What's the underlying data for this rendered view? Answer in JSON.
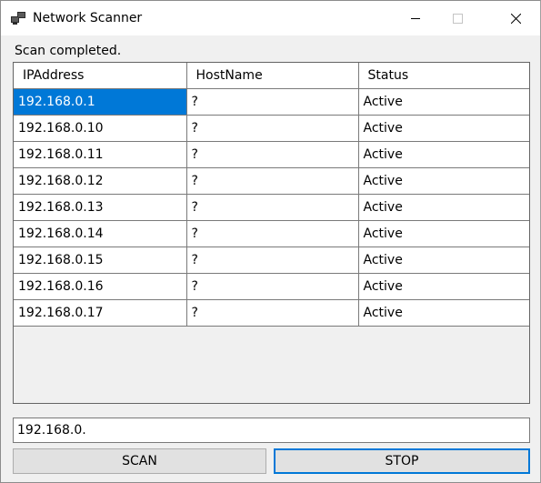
{
  "window": {
    "title": "Network Scanner",
    "icon": "network-computers-icon",
    "controls": [
      "minimize-icon",
      "maximize-icon",
      "close-icon"
    ]
  },
  "status": {
    "text": "Scan completed."
  },
  "grid": {
    "columns": [
      "IPAddress",
      "HostName",
      "Status"
    ],
    "rows": [
      {
        "ip": "192.168.0.1",
        "host": "?",
        "status": "Active"
      },
      {
        "ip": "192.168.0.10",
        "host": "?",
        "status": "Active"
      },
      {
        "ip": "192.168.0.11",
        "host": "?",
        "status": "Active"
      },
      {
        "ip": "192.168.0.12",
        "host": "?",
        "status": "Active"
      },
      {
        "ip": "192.168.0.13",
        "host": "?",
        "status": "Active"
      },
      {
        "ip": "192.168.0.14",
        "host": "?",
        "status": "Active"
      },
      {
        "ip": "192.168.0.15",
        "host": "?",
        "status": "Active"
      },
      {
        "ip": "192.168.0.16",
        "host": "?",
        "status": "Active"
      },
      {
        "ip": "192.168.0.17",
        "host": "?",
        "status": "Active"
      }
    ],
    "selected_row": 0,
    "selection_color": "#0078d7"
  },
  "address": {
    "value": "192.168.0."
  },
  "buttons": {
    "scan_label": "SCAN",
    "stop_label": "STOP"
  },
  "colors": {
    "accent": "#0078d7",
    "window_bg": "#f0f0f0",
    "button_bg": "#e1e1e1"
  }
}
